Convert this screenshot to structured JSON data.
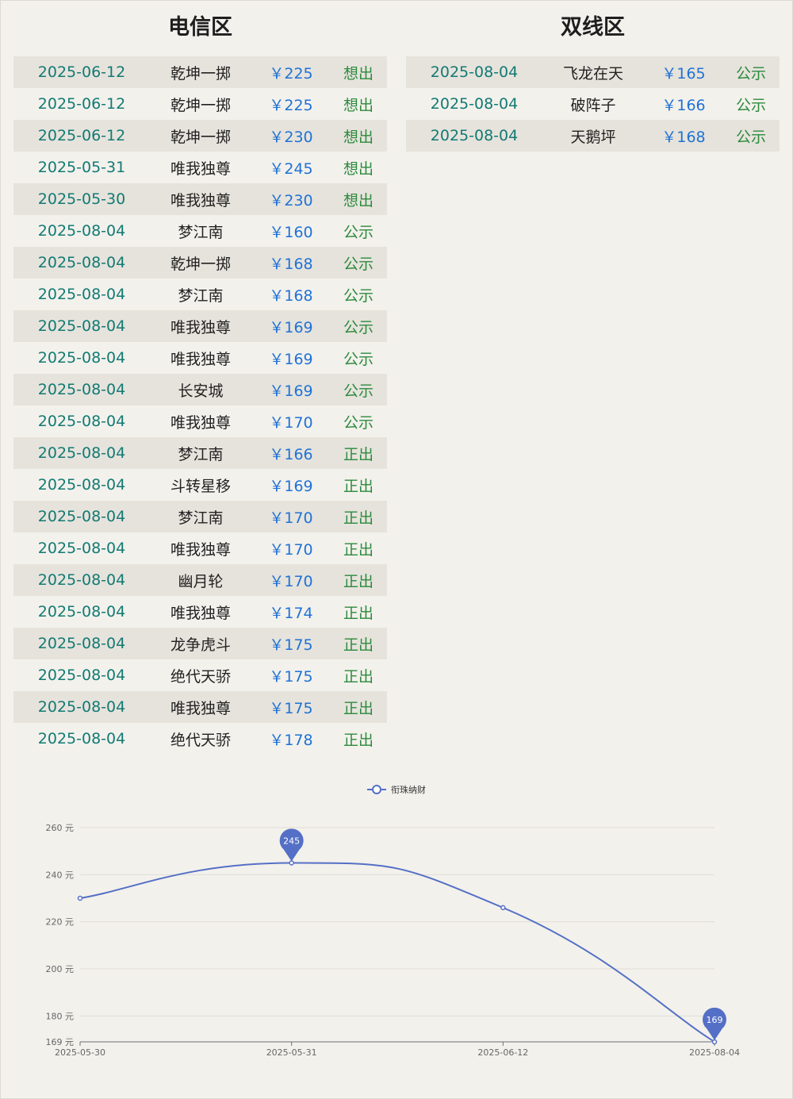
{
  "telecom": {
    "title": "电信区",
    "rows": [
      {
        "date": "2025-06-12",
        "name": "乾坤一掷",
        "price": "￥225",
        "status": "想出"
      },
      {
        "date": "2025-06-12",
        "name": "乾坤一掷",
        "price": "￥225",
        "status": "想出"
      },
      {
        "date": "2025-06-12",
        "name": "乾坤一掷",
        "price": "￥230",
        "status": "想出"
      },
      {
        "date": "2025-05-31",
        "name": "唯我独尊",
        "price": "￥245",
        "status": "想出"
      },
      {
        "date": "2025-05-30",
        "name": "唯我独尊",
        "price": "￥230",
        "status": "想出"
      },
      {
        "date": "2025-08-04",
        "name": "梦江南",
        "price": "￥160",
        "status": "公示"
      },
      {
        "date": "2025-08-04",
        "name": "乾坤一掷",
        "price": "￥168",
        "status": "公示"
      },
      {
        "date": "2025-08-04",
        "name": "梦江南",
        "price": "￥168",
        "status": "公示"
      },
      {
        "date": "2025-08-04",
        "name": "唯我独尊",
        "price": "￥169",
        "status": "公示"
      },
      {
        "date": "2025-08-04",
        "name": "唯我独尊",
        "price": "￥169",
        "status": "公示"
      },
      {
        "date": "2025-08-04",
        "name": "长安城",
        "price": "￥169",
        "status": "公示"
      },
      {
        "date": "2025-08-04",
        "name": "唯我独尊",
        "price": "￥170",
        "status": "公示"
      },
      {
        "date": "2025-08-04",
        "name": "梦江南",
        "price": "￥166",
        "status": "正出"
      },
      {
        "date": "2025-08-04",
        "name": "斗转星移",
        "price": "￥169",
        "status": "正出"
      },
      {
        "date": "2025-08-04",
        "name": "梦江南",
        "price": "￥170",
        "status": "正出"
      },
      {
        "date": "2025-08-04",
        "name": "唯我独尊",
        "price": "￥170",
        "status": "正出"
      },
      {
        "date": "2025-08-04",
        "name": "幽月轮",
        "price": "￥170",
        "status": "正出"
      },
      {
        "date": "2025-08-04",
        "name": "唯我独尊",
        "price": "￥174",
        "status": "正出"
      },
      {
        "date": "2025-08-04",
        "name": "龙争虎斗",
        "price": "￥175",
        "status": "正出"
      },
      {
        "date": "2025-08-04",
        "name": "绝代天骄",
        "price": "￥175",
        "status": "正出"
      },
      {
        "date": "2025-08-04",
        "name": "唯我独尊",
        "price": "￥175",
        "status": "正出"
      },
      {
        "date": "2025-08-04",
        "name": "绝代天骄",
        "price": "￥178",
        "status": "正出"
      }
    ]
  },
  "dualline": {
    "title": "双线区",
    "rows": [
      {
        "date": "2025-08-04",
        "name": "飞龙在天",
        "price": "￥165",
        "status": "公示"
      },
      {
        "date": "2025-08-04",
        "name": "破阵子",
        "price": "￥166",
        "status": "公示"
      },
      {
        "date": "2025-08-04",
        "name": "天鹅坪",
        "price": "￥168",
        "status": "公示"
      }
    ]
  },
  "colors": {
    "series": "#5470c6",
    "date_text": "#127a73",
    "price_text": "#1f72d6",
    "status_text": "#2c8a3d",
    "stripe": "#e6e3dc",
    "background": "#f3f1ec"
  },
  "chart_data": {
    "type": "line",
    "smooth": true,
    "title": "",
    "xlabel": "",
    "ylabel": "",
    "legend": {
      "position": "top-center",
      "entries": [
        "衔珠纳财"
      ]
    },
    "categories": [
      "2025-05-30",
      "2025-05-31",
      "2025-06-12",
      "2025-08-04"
    ],
    "series": [
      {
        "name": "衔珠纳财",
        "values": [
          230,
          245,
          226,
          169
        ]
      }
    ],
    "ylim": [
      169,
      260
    ],
    "yticks": [
      169,
      180,
      200,
      220,
      240,
      260
    ],
    "ytick_suffix": " 元",
    "grid": true,
    "markers": [
      {
        "label": "245",
        "category": "2025-05-31",
        "value": 245,
        "kind": "max"
      },
      {
        "label": "169",
        "category": "2025-08-04",
        "value": 169,
        "kind": "min"
      }
    ]
  }
}
